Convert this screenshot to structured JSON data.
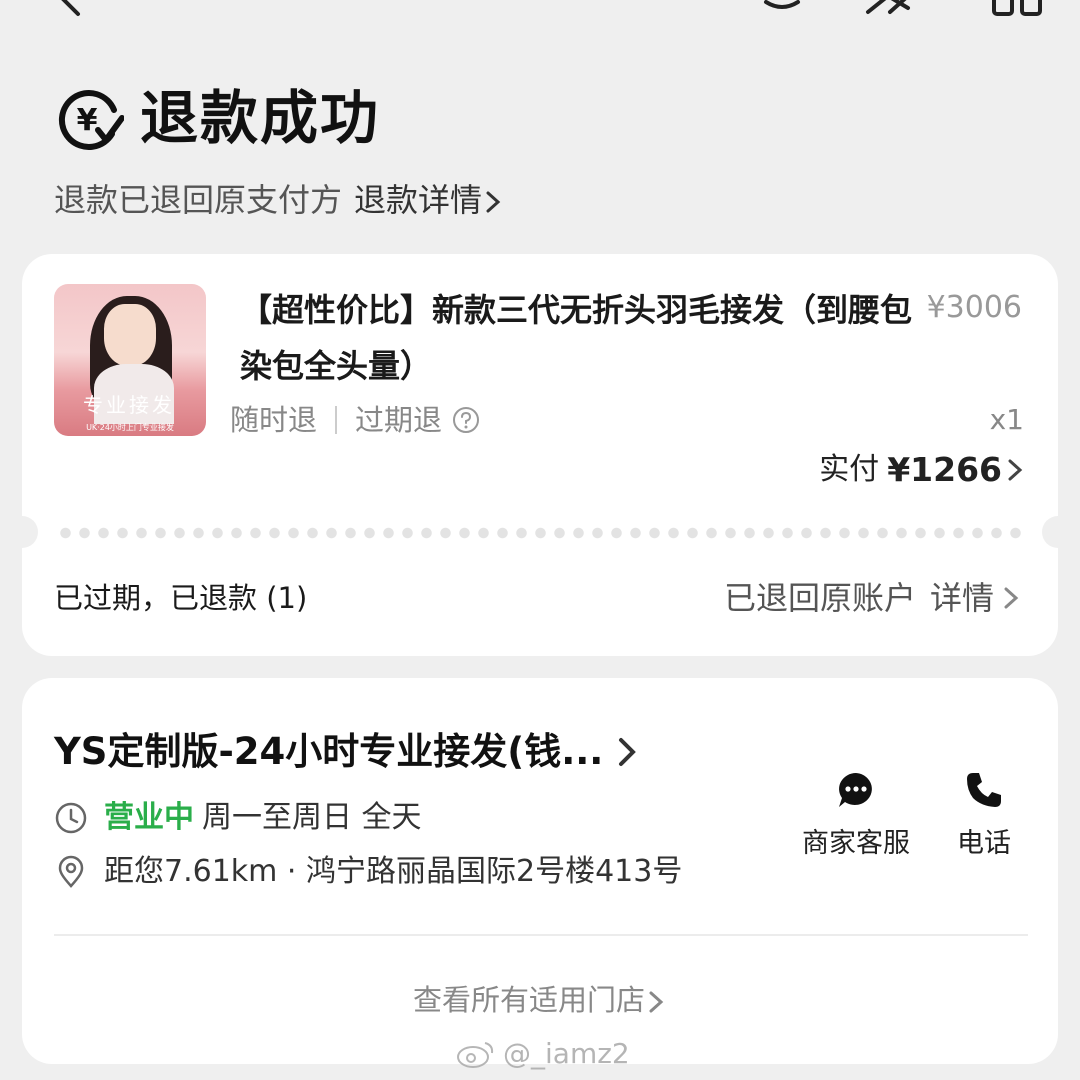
{
  "header": {
    "status_title": "退款成功",
    "status_subtitle": "退款已退回原支付方",
    "refund_detail_link": "退款详情"
  },
  "product": {
    "title": "【超性价比】新款三代无折头羽毛接发（到腰包染包全头量）",
    "original_price": "¥3006",
    "tag_anytime_refund": "随时退",
    "tag_expired_refund": "过期退",
    "quantity": "x1",
    "paid_label": "实付",
    "paid_amount": "¥1266",
    "thumbnail_banner": "专业接发",
    "thumbnail_tagline": "UK·24小时上门专业接发"
  },
  "refund": {
    "status": "已过期，已退款 (1)",
    "destination": "已退回原账户",
    "detail_link": "详情"
  },
  "store": {
    "name": "YS定制版-24小时专业接发(钱...",
    "open_status": "营业中",
    "hours": "周一至周日 全天",
    "address": "距您7.61km · 鸿宁路丽晶国际2号楼413号",
    "service_label": "商家客服",
    "phone_label": "电话",
    "all_stores_link": "查看所有适用门店"
  },
  "watermark": "@_iamz2",
  "colors": {
    "background": "#efefef",
    "card": "#ffffff",
    "open_green": "#2aae4a",
    "muted_text": "#888888"
  }
}
